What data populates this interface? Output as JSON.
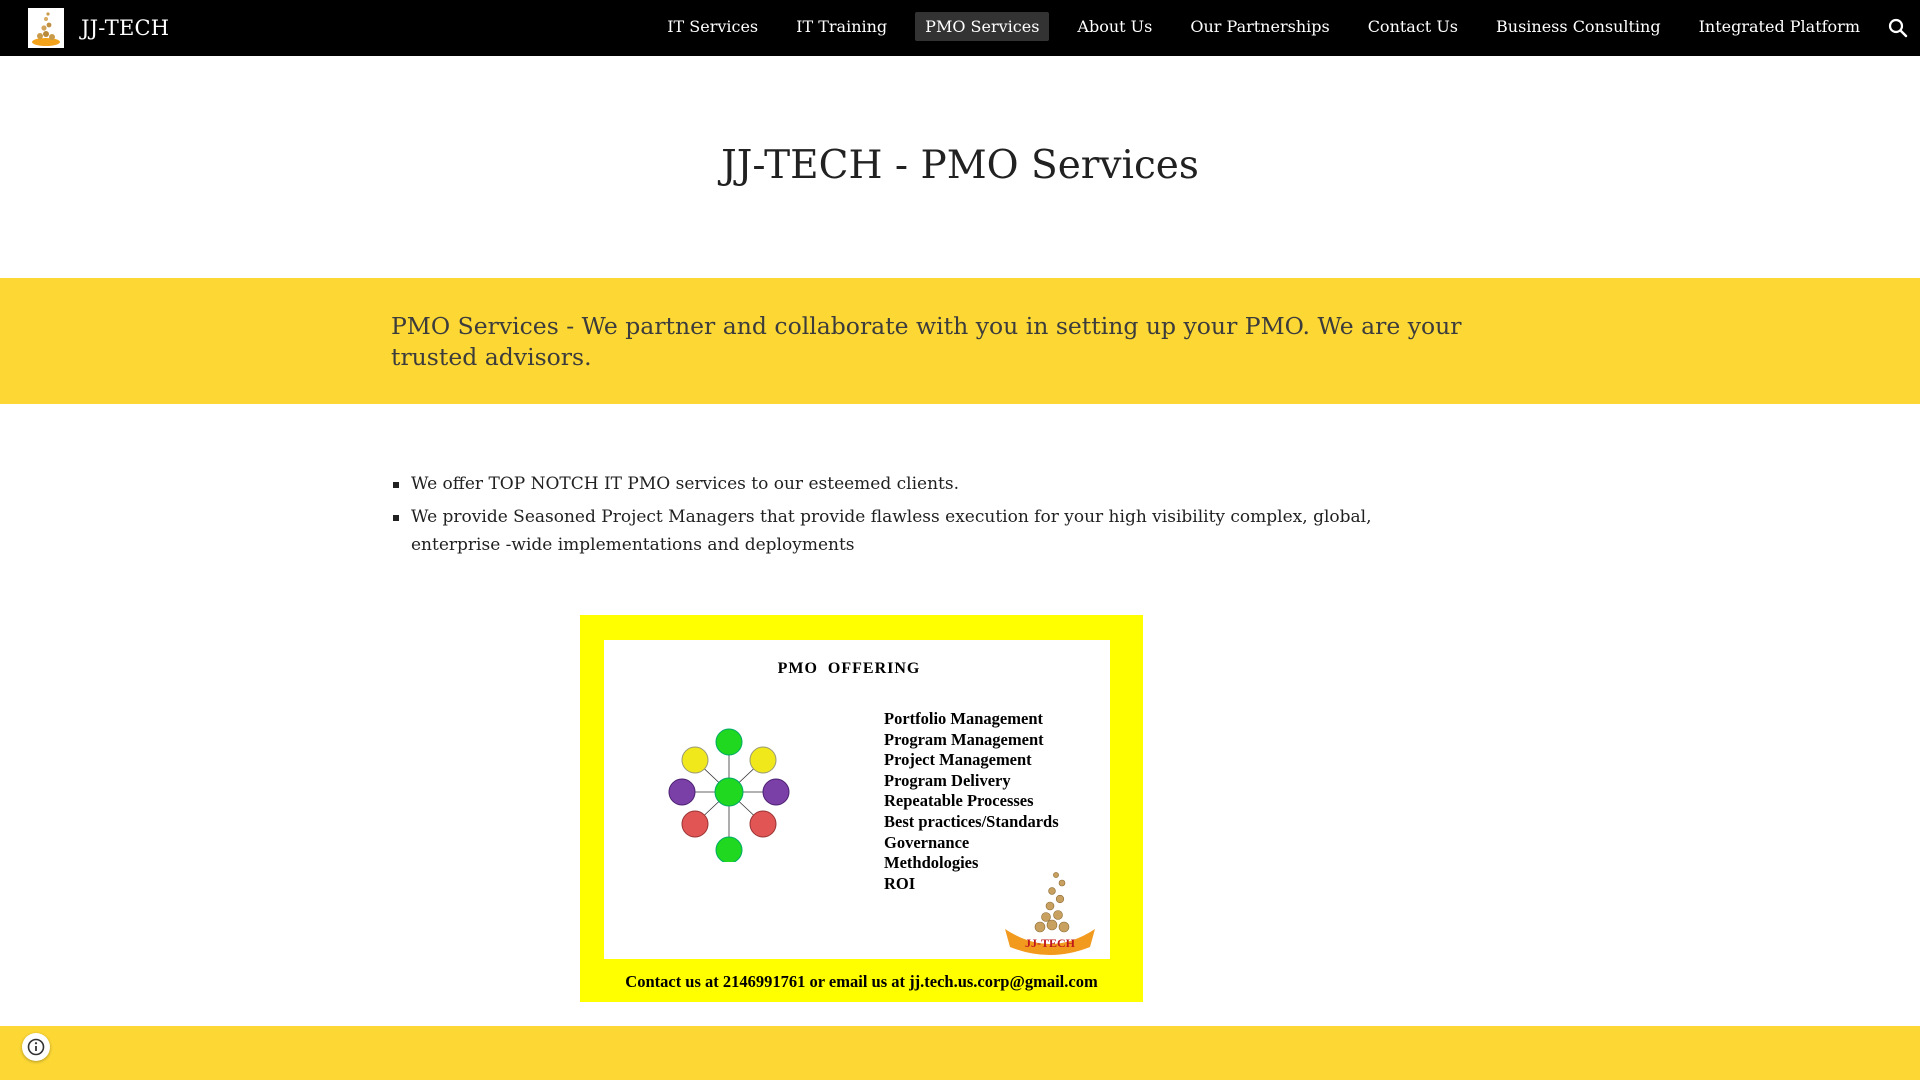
{
  "site": {
    "name": "JJ-TECH"
  },
  "nav": {
    "items": [
      {
        "label": "IT Services"
      },
      {
        "label": "IT Training"
      },
      {
        "label": "PMO Services"
      },
      {
        "label": "About Us"
      },
      {
        "label": "Our Partnerships"
      },
      {
        "label": "Contact Us"
      },
      {
        "label": "Business Consulting"
      },
      {
        "label": "Integrated Platform"
      }
    ],
    "active": "PMO Services"
  },
  "page": {
    "title": "JJ-TECH - PMO Services"
  },
  "banner": {
    "text": "PMO Services - We partner and collaborate with you in setting up your PMO. We are your trusted advisors."
  },
  "bullets": [
    "We offer TOP NOTCH IT PMO services to our esteemed clients.",
    "We provide Seasoned Project Managers that provide flawless execution for your high visibility complex, global, enterprise -wide implementations and deployments"
  ],
  "offer_image": {
    "title": "PMO  OFFERING",
    "items": [
      "Portfolio Management",
      "Program Management",
      "Project Management",
      "Program Delivery",
      "Repeatable Processes",
      "Best practices/Standards",
      "Governance",
      "Methdologies",
      "ROI"
    ],
    "logo_text": "JJ-TECH",
    "contact": "Contact us at 2146991761 or email us at jj.tech.us.corp@gmail.com"
  },
  "colors": {
    "topbar": "#000000",
    "banner": "#fdd835",
    "card": "#ffff00",
    "active_nav": "#333333"
  },
  "icons": {
    "search": "search-icon",
    "info": "info-icon"
  }
}
